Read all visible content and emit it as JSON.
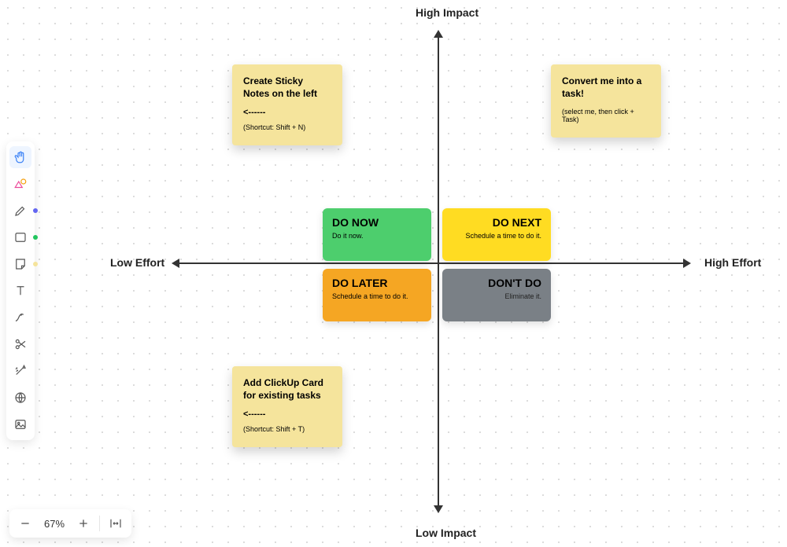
{
  "axes": {
    "top": "High Impact",
    "bottom": "Low Impact",
    "left": "Low Effort",
    "right": "High Effort"
  },
  "quadrants": {
    "doNow": {
      "title": "DO NOW",
      "sub": "Do it now."
    },
    "doNext": {
      "title": "DO NEXT",
      "sub": "Schedule a time to do it."
    },
    "doLater": {
      "title": "DO LATER",
      "sub": "Schedule a time to do it."
    },
    "dontDo": {
      "title": "DON'T DO",
      "sub": "Eliminate it."
    }
  },
  "stickies": {
    "s1": {
      "title": "Create Sticky Notes on the left",
      "arrow": "<------",
      "sub": "(Shortcut: Shift + N)"
    },
    "s2": {
      "title": "Convert me into a task!",
      "sub": "(select me, then click + Task)"
    },
    "s3": {
      "title": "Add ClickUp Card for existing tasks",
      "arrow": "<------",
      "sub": "(Shortcut: Shift + T)"
    }
  },
  "zoom": {
    "level": "67%"
  },
  "colors": {
    "doNow": "#4dce6d",
    "doNext": "#ffdc22",
    "doLater": "#f5a623",
    "dontDo": "#7a8086",
    "sticky": "#f5e49c"
  }
}
